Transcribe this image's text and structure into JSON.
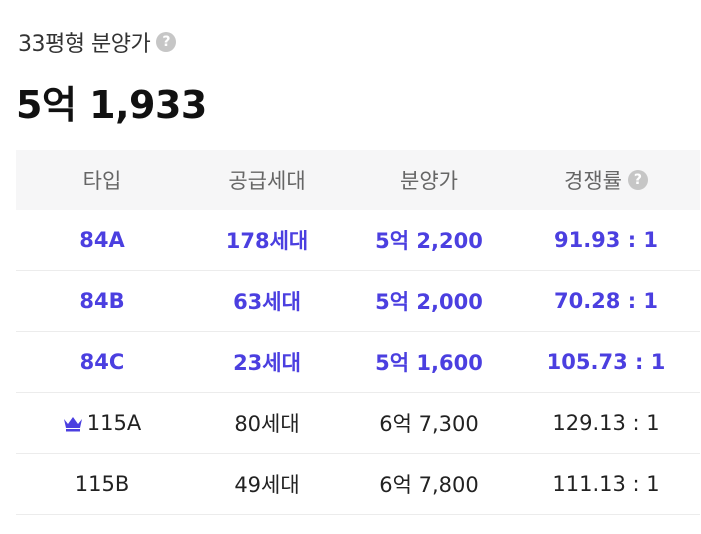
{
  "header": {
    "subtitle": "33평형 분양가",
    "help_glyph": "?",
    "price": "5억 1,933"
  },
  "table": {
    "columns": [
      "타입",
      "공급세대",
      "분양가",
      "경쟁률"
    ],
    "rows": [
      {
        "type": "84A",
        "units": "178세대",
        "price": "5억 2,200",
        "ratio": "91.93 : 1"
      },
      {
        "type": "84B",
        "units": "63세대",
        "price": "5억 2,000",
        "ratio": "70.28 : 1"
      },
      {
        "type": "84C",
        "units": "23세대",
        "price": "5억 1,600",
        "ratio": "105.73 : 1"
      },
      {
        "type": "115A",
        "units": "80세대",
        "price": "6억 7,300",
        "ratio": "129.13 : 1"
      },
      {
        "type": "115B",
        "units": "49세대",
        "price": "6억 7,800",
        "ratio": "111.13 : 1"
      }
    ]
  },
  "colors": {
    "highlight": "#4b3fe0",
    "header_bg": "#f6f6f7",
    "help_icon": "#c6c6c6"
  },
  "icons": {
    "help": "question-circle-icon",
    "crown": "crown-icon"
  }
}
